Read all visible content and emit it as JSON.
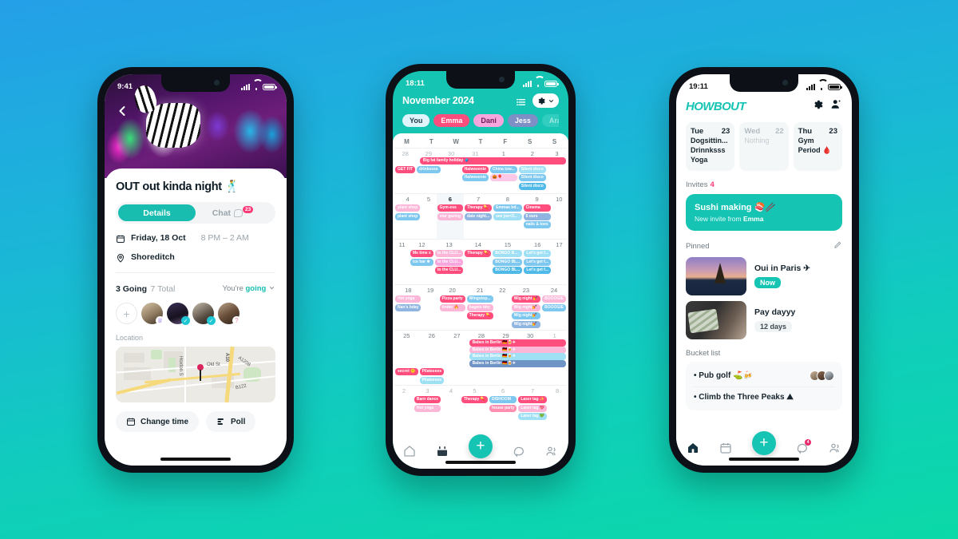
{
  "background": {
    "top_color": "#249fe8",
    "bottom_color": "#0bd9a8"
  },
  "phone1": {
    "status": {
      "time": "9:41"
    },
    "back_icon": "chevron-left-icon",
    "event": {
      "title": "OUT out kinda night 🕺",
      "tabs": [
        {
          "label": "Details",
          "active": true
        },
        {
          "label": "Chat",
          "active": false,
          "badge": "23"
        }
      ],
      "date": "Friday, 18 Oct",
      "time": "8 PM – 2 AM",
      "location_name": "Shoreditch",
      "going_count": "3 Going",
      "total_count": "7 Total",
      "rsvp_prefix": "You're",
      "rsvp_value": "going",
      "avatars": [
        {
          "name": "add",
          "marker": "+"
        },
        {
          "name": "guest-1",
          "marker": "crown"
        },
        {
          "name": "guest-2",
          "marker": "check"
        },
        {
          "name": "guest-3",
          "marker": "check"
        },
        {
          "name": "guest-4",
          "marker": "question"
        }
      ],
      "location_label": "Location",
      "map": {
        "pin_label": "Old St",
        "street_labels": [
          "Hoxton S",
          "A10",
          "A1208",
          "B122"
        ]
      },
      "actions": [
        {
          "label": "Change time",
          "icon": "calendar-icon"
        },
        {
          "label": "Poll",
          "icon": "poll-icon"
        }
      ]
    }
  },
  "phone2": {
    "status": {
      "time": "18:11"
    },
    "calendar": {
      "month_title": "November 2024",
      "list_icon": "list-view-icon",
      "gear_icon": "gear-icon",
      "chevron_icon": "chevron-down-icon",
      "chips": [
        {
          "label": "You",
          "bg": "#dff4fb",
          "fg": "#1b3b49"
        },
        {
          "label": "Emma",
          "bg": "#ff4d7e",
          "fg": "#ffffff"
        },
        {
          "label": "Dani",
          "bg": "#f9a6de",
          "fg": "#6b1f52"
        },
        {
          "label": "Jess",
          "bg": "#7d8fc4",
          "fg": "#ffffff"
        },
        {
          "label": "Arabella",
          "bg": "#31cdbe",
          "fg": "#9fe9e1"
        },
        {
          "label": "Ar",
          "bg": "#31cdbe",
          "fg": "#9fe9e1"
        }
      ],
      "weekday_headers": [
        "M",
        "T",
        "W",
        "T",
        "F",
        "S",
        "S"
      ],
      "weeks": [
        {
          "days": [
            {
              "num": "28",
              "muted": true,
              "events": [
                {
                  "t": "GET FIT",
                  "bg": "#ff4d7e"
                }
              ]
            },
            {
              "num": "29",
              "muted": true,
              "events": [
                {
                  "t": "drinkssss",
                  "bg": "#7ec8ef"
                }
              ]
            },
            {
              "num": "30",
              "muted": true,
              "events": []
            },
            {
              "num": "31",
              "muted": true,
              "events": [
                {
                  "t": "Halweeenie",
                  "bg": "#ff4d7e"
                },
                {
                  "t": "Halweeenie",
                  "bg": "#7ec8ef"
                }
              ]
            },
            {
              "num": "1",
              "muted": false,
              "events": [
                {
                  "t": "China tow...",
                  "bg": "#7ec8ef"
                },
                {
                  "t": "🎃🎈",
                  "bg": "#fbc8e8"
                }
              ]
            },
            {
              "num": "2",
              "muted": false,
              "events": [
                {
                  "t": "Silent disco",
                  "bg": "#9fe0f5"
                },
                {
                  "t": "Silent disco",
                  "bg": "#7ec8ef"
                },
                {
                  "t": "Silent disco",
                  "bg": "#4fb9e8"
                }
              ]
            },
            {
              "num": "3",
              "muted": false,
              "events": []
            }
          ],
          "spans": [
            {
              "t": "Big fat family holiday 🧳",
              "bg": "#ff4d7e",
              "start": 1,
              "len": 6
            }
          ]
        },
        {
          "days": [
            {
              "num": "4",
              "muted": false,
              "events": [
                {
                  "t": "plant shop",
                  "bg": "#fbb6d8"
                },
                {
                  "t": "plant shop",
                  "bg": "#7ec8ef"
                }
              ]
            },
            {
              "num": "5",
              "muted": false,
              "events": []
            },
            {
              "num": "6",
              "muted": false,
              "today": true,
              "events": [
                {
                  "t": "Gym-ess",
                  "bg": "#ff4d7e"
                },
                {
                  "t": "star gazing",
                  "bg": "#fbb6d8"
                }
              ]
            },
            {
              "num": "7",
              "muted": false,
              "events": [
                {
                  "t": "Therapy 💊",
                  "bg": "#ff4d7e"
                },
                {
                  "t": "date night...",
                  "bg": "#8fb5e0"
                }
              ]
            },
            {
              "num": "8",
              "muted": false,
              "events": [
                {
                  "t": "Emmas bd...",
                  "bg": "#7ec8ef"
                },
                {
                  "t": "see joe<3...",
                  "bg": "#9fe0f5"
                }
              ]
            },
            {
              "num": "9",
              "muted": false,
              "events": [
                {
                  "t": "Cinema",
                  "bg": "#ff4d7e"
                },
                {
                  "t": "6 ours",
                  "bg": "#8fb5e0"
                },
                {
                  "t": "nails & toes",
                  "bg": "#7ec8ef"
                }
              ]
            },
            {
              "num": "10",
              "muted": false,
              "events": []
            }
          ],
          "spans": []
        },
        {
          "days": [
            {
              "num": "11",
              "muted": false,
              "events": []
            },
            {
              "num": "12",
              "muted": false,
              "events": [
                {
                  "t": "Me time x",
                  "bg": "#ff4d7e"
                },
                {
                  "t": "ice bar ❄",
                  "bg": "#7ec8ef"
                }
              ]
            },
            {
              "num": "13",
              "muted": false,
              "events": [
                {
                  "t": "to the CLU...",
                  "bg": "#fbb6d8"
                },
                {
                  "t": "to the CLU...",
                  "bg": "#f9a6de"
                },
                {
                  "t": "to the CLU...",
                  "bg": "#ff4d7e"
                }
              ]
            },
            {
              "num": "14",
              "muted": false,
              "events": [
                {
                  "t": "Therapy 💊",
                  "bg": "#ff4d7e"
                }
              ]
            },
            {
              "num": "15",
              "muted": false,
              "events": [
                {
                  "t": "BONGO B...",
                  "bg": "#9fe0f5"
                },
                {
                  "t": "BONGO BL...",
                  "bg": "#7ec8ef"
                },
                {
                  "t": "BONGO BL...",
                  "bg": "#4fb9e8"
                }
              ]
            },
            {
              "num": "16",
              "muted": false,
              "events": [
                {
                  "t": "Let's get f...",
                  "bg": "#9fe0f5"
                },
                {
                  "t": "Let's get f...",
                  "bg": "#7ec8ef"
                },
                {
                  "t": "Let's get f...",
                  "bg": "#4fb9e8"
                }
              ]
            },
            {
              "num": "17",
              "muted": false,
              "events": []
            }
          ],
          "spans": []
        },
        {
          "days": [
            {
              "num": "18",
              "muted": false,
              "events": [
                {
                  "t": "Hot yoga",
                  "bg": "#fbb6d8"
                },
                {
                  "t": "Nan's bday",
                  "bg": "#8fb5e0"
                }
              ]
            },
            {
              "num": "19",
              "muted": false,
              "events": []
            },
            {
              "num": "20",
              "muted": false,
              "events": [
                {
                  "t": "Pizza party",
                  "bg": "#ff4d7e"
                },
                {
                  "t": "tinder 🔥",
                  "bg": "#fbb6d8"
                }
              ]
            },
            {
              "num": "21",
              "muted": false,
              "events": [
                {
                  "t": "Wingstop...",
                  "bg": "#7ec8ef"
                },
                {
                  "t": "bagels bby",
                  "bg": "#fbb6d8"
                },
                {
                  "t": "Therapy 💊",
                  "bg": "#ff4d7e"
                }
              ]
            },
            {
              "num": "22",
              "muted": false,
              "events": []
            },
            {
              "num": "23",
              "muted": false,
              "events": [
                {
                  "t": "Wig night 💅",
                  "bg": "#ff4d7e"
                },
                {
                  "t": "Wig night💅",
                  "bg": "#fbb6d8"
                },
                {
                  "t": "Wig night💅",
                  "bg": "#7ec8ef"
                },
                {
                  "t": "Wig night💅",
                  "bg": "#8fb5e0"
                }
              ]
            },
            {
              "num": "24",
              "muted": false,
              "events": [
                {
                  "t": "BOOOGIE",
                  "bg": "#fbb6d8"
                },
                {
                  "t": "BOOOGIE",
                  "bg": "#7ec8ef"
                }
              ]
            }
          ],
          "spans": []
        },
        {
          "days": [
            {
              "num": "25",
              "muted": false,
              "events": [
                {
                  "t": "secret 🤫",
                  "bg": "#ff4d7e"
                }
              ]
            },
            {
              "num": "26",
              "muted": false,
              "events": [
                {
                  "t": "Pilateeees",
                  "bg": "#ff4d7e"
                },
                {
                  "t": "Pilateeees",
                  "bg": "#9fe0f5"
                }
              ]
            },
            {
              "num": "27",
              "muted": false,
              "events": []
            },
            {
              "num": "28",
              "muted": false,
              "events": []
            },
            {
              "num": "29",
              "muted": false,
              "events": []
            },
            {
              "num": "30",
              "muted": false,
              "events": []
            },
            {
              "num": "1",
              "muted": true,
              "events": []
            }
          ],
          "spans": [
            {
              "t": "Babes in Berlin 🇩🇪🍺✈",
              "bg": "#ff4d7e",
              "start": 3,
              "len": 4,
              "row": 0
            },
            {
              "t": "Babes in Berlin 🇩🇪🍺✈",
              "bg": "#fbb6d8",
              "start": 3,
              "len": 4,
              "row": 1
            },
            {
              "t": "Babes in Berlin 🇩🇪🍺✈",
              "bg": "#9fe0f5",
              "start": 3,
              "len": 4,
              "row": 2
            },
            {
              "t": "Babes in Berlin 🇩🇪🍺✈",
              "bg": "#6f93c4",
              "start": 3,
              "len": 4,
              "row": 3
            }
          ]
        },
        {
          "days": [
            {
              "num": "2",
              "muted": true,
              "events": []
            },
            {
              "num": "3",
              "muted": true,
              "events": [
                {
                  "t": "Barn dance",
                  "bg": "#ff4d7e"
                },
                {
                  "t": "Hot yoga",
                  "bg": "#fbb6d8"
                }
              ]
            },
            {
              "num": "4",
              "muted": true,
              "events": []
            },
            {
              "num": "5",
              "muted": true,
              "events": [
                {
                  "t": "Therapy 💊",
                  "bg": "#ff4d7e"
                }
              ]
            },
            {
              "num": "6",
              "muted": true,
              "events": [
                {
                  "t": "DISHOOM",
                  "bg": "#7ec8ef"
                },
                {
                  "t": "house party",
                  "bg": "#ff8fb0"
                }
              ]
            },
            {
              "num": "7",
              "muted": true,
              "events": [
                {
                  "t": "Laser tag ✨",
                  "bg": "#ff4d7e"
                },
                {
                  "t": "Laser tag 💖",
                  "bg": "#fbb6d8"
                },
                {
                  "t": "Laser tag 💚",
                  "bg": "#9fe0f5"
                }
              ]
            },
            {
              "num": "8",
              "muted": true,
              "events": []
            }
          ],
          "spans": []
        }
      ]
    },
    "tabbar": [
      {
        "icon": "home-icon",
        "active": false
      },
      {
        "icon": "calendar-icon",
        "active": true
      },
      {
        "icon": "add-icon",
        "fab": true,
        "label": "+"
      },
      {
        "icon": "chat-icon",
        "active": false
      },
      {
        "icon": "friends-icon",
        "active": false
      }
    ]
  },
  "phone3": {
    "status": {
      "time": "19:11"
    },
    "brand": "HOWBOUT",
    "header_icons": [
      {
        "name": "gear-icon"
      },
      {
        "name": "add-person-icon"
      }
    ],
    "day_cards": [
      {
        "day": "Tue",
        "num": "23",
        "items": [
          "Dogsittin...",
          "Drinnksss",
          "Yoga"
        ],
        "muted": false
      },
      {
        "day": "Wed",
        "num": "22",
        "items": [
          "Nothing"
        ],
        "muted": true
      },
      {
        "day": "Thu",
        "num": "23",
        "items": [
          "Gym",
          "Period 🩸"
        ],
        "muted": false
      }
    ],
    "invites": {
      "label": "Invites",
      "count": "4",
      "card": {
        "title": "Sushi making 🍣🥢",
        "subtitle_prefix": "New invite from",
        "subtitle_name": "Emma"
      }
    },
    "pinned": {
      "label": "Pinned",
      "edit_icon": "pencil-icon",
      "items": [
        {
          "title": "Oui in Paris ✈",
          "tag": "Now",
          "tag_style": "now",
          "image": "paris"
        },
        {
          "title": "Pay dayyy",
          "tag": "12 days",
          "tag_style": "days",
          "image": "money"
        }
      ]
    },
    "bucket_list": {
      "label": "Bucket list",
      "items": [
        {
          "text": "• Pub golf ⛳🍻",
          "avatars": 3
        },
        {
          "text": "• Climb the Three Peaks ⛰",
          "avatars": 0
        }
      ]
    },
    "tabbar": [
      {
        "icon": "home-icon",
        "active": true
      },
      {
        "icon": "calendar-icon",
        "active": false
      },
      {
        "icon": "add-icon",
        "fab": true,
        "label": "+"
      },
      {
        "icon": "chat-icon",
        "active": false,
        "badge": "4"
      },
      {
        "icon": "friends-icon",
        "active": false
      }
    ]
  }
}
